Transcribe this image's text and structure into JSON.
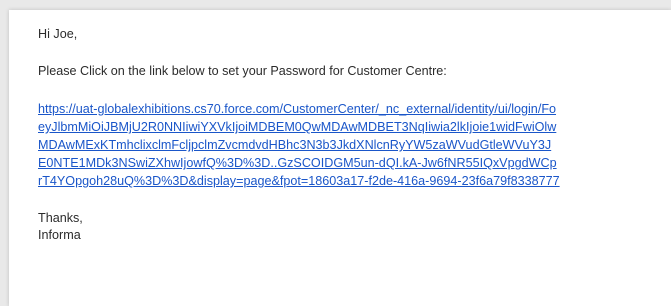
{
  "email": {
    "greeting": "Hi Joe,",
    "instruction": "Please Click on the link below to set your Password for Customer Centre:",
    "link_lines": [
      "https://uat-globalexhibitions.cs70.force.com/CustomerCenter/_nc_external/identity/ui/login/Fo",
      "eyJlbmMiOiJBMjU2R0NNIiwiYXVkIjoiMDBEM0QwMDAwMDBET3NqIiwia2lkIjoie1widFwiOlw",
      "MDAwMExKTmhclixclmFcljpclmZvcmdvdHBhc3N3b3JkdXNlcnRyYW5zaWVudGtleWVuY3J",
      "E0NTE1MDk3NSwiZXhwIjowfQ%3D%3D..GzSCOIDGM5un-dQI.kA-Jw6fNR55IQxVpgdWCp",
      "rT4YOpgoh28uQ%3D%3D&display=page&fpot=18603a17-f2de-416a-9694-23f6a79f8338777"
    ],
    "closing": "Thanks,",
    "signature": "Informa"
  },
  "colors": {
    "text": "#2b2b2b",
    "link": "#1a56c9",
    "background": "#e9e9e9"
  }
}
